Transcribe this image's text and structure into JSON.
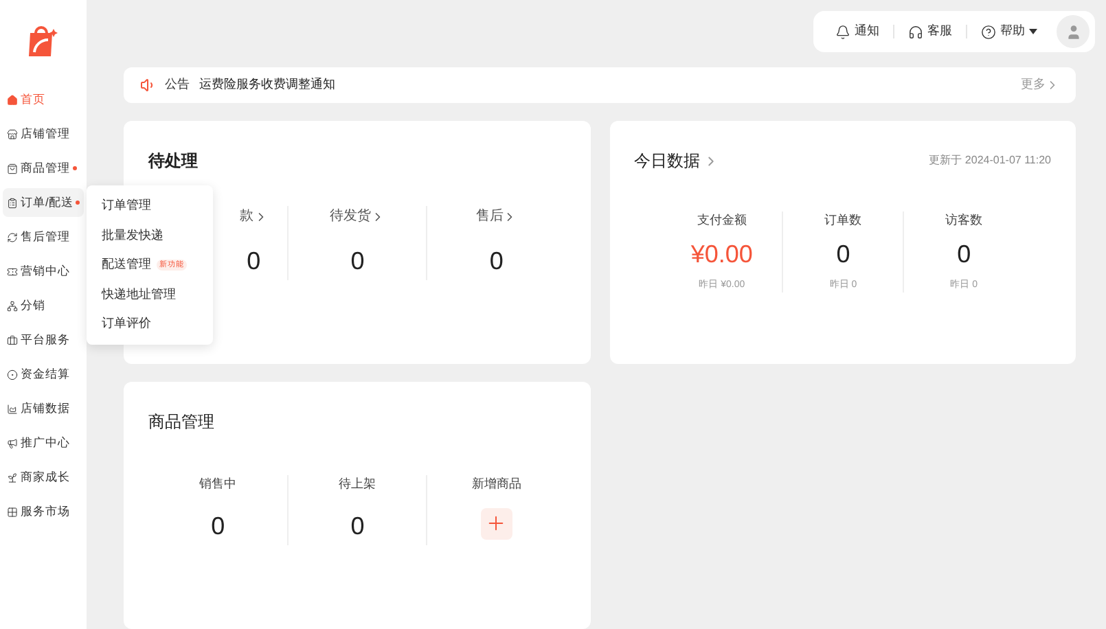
{
  "topbar": {
    "items": [
      {
        "kind": "bell",
        "label": "通知"
      },
      {
        "kind": "headset",
        "label": "客服"
      },
      {
        "kind": "help",
        "label": "帮助"
      }
    ]
  },
  "sidebar": {
    "items": [
      {
        "label": "首页",
        "selected": true,
        "dot": false,
        "expanded": false
      },
      {
        "label": "店铺管理",
        "selected": false,
        "dot": false,
        "expanded": false
      },
      {
        "label": "商品管理",
        "selected": false,
        "dot": true,
        "expanded": false
      },
      {
        "label": "订单/配送",
        "selected": false,
        "dot": true,
        "expanded": true,
        "children": [
          {
            "label": "订单管理"
          },
          {
            "label": "批量发快递"
          },
          {
            "label": "配送管理",
            "badge": "新功能"
          },
          {
            "label": "快递地址管理"
          },
          {
            "label": "订单评价"
          }
        ]
      },
      {
        "label": "售后管理",
        "selected": false,
        "dot": false,
        "expanded": false
      },
      {
        "label": "营销中心",
        "selected": false,
        "dot": false,
        "expanded": false
      },
      {
        "label": "分销",
        "selected": false,
        "dot": false,
        "expanded": false
      },
      {
        "label": "平台服务",
        "selected": false,
        "dot": false,
        "expanded": false
      },
      {
        "label": "资金结算",
        "selected": false,
        "dot": false,
        "expanded": false
      },
      {
        "label": "店铺数据",
        "selected": false,
        "dot": false,
        "expanded": false
      },
      {
        "label": "推广中心",
        "selected": false,
        "dot": false,
        "expanded": false
      },
      {
        "label": "商家成长",
        "selected": false,
        "dot": false,
        "expanded": false
      },
      {
        "label": "服务市场",
        "selected": false,
        "dot": false,
        "expanded": false
      }
    ]
  },
  "notice": {
    "tag": "公告",
    "text": "运费险服务收费调整通知",
    "more": "更多"
  },
  "pending": {
    "title": "待处理",
    "stats": [
      {
        "label": "款",
        "value": "0"
      },
      {
        "label": "待发货",
        "value": "0"
      },
      {
        "label": "售后",
        "value": "0"
      }
    ]
  },
  "today": {
    "title": "今日数据",
    "updated": "更新于 2024-01-07 11:20",
    "stats": [
      {
        "label": "支付金额",
        "value": "¥0.00",
        "highlight": true,
        "sub": "昨日 ¥0.00"
      },
      {
        "label": "订单数",
        "value": "0",
        "highlight": false,
        "sub": "昨日 0"
      },
      {
        "label": "访客数",
        "value": "0",
        "highlight": false,
        "sub": "昨日 0"
      }
    ]
  },
  "products": {
    "title": "商品管理",
    "stats": [
      {
        "kind": "count",
        "label": "销售中",
        "value": "0"
      },
      {
        "kind": "count",
        "label": "待上架",
        "value": "0"
      },
      {
        "kind": "add",
        "label": "新增商品"
      }
    ]
  }
}
